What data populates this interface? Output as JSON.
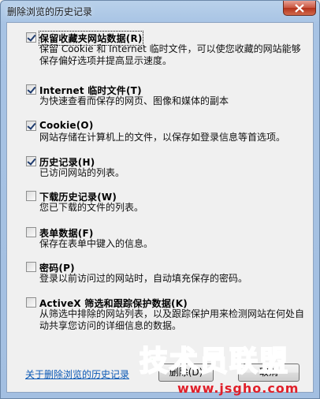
{
  "window": {
    "title": "删除浏览的历史记录"
  },
  "options": [
    {
      "label": "保留收藏夹网站数据(R)",
      "checked": true,
      "desc": "保留 Cookie 和 Internet 临时文件，可以使您收藏的网站能够保存偏好选项并提高显示速度。"
    },
    {
      "label": "Internet 临时文件(T)",
      "checked": true,
      "desc": "为快速查看而保存的网页、图像和媒体的副本"
    },
    {
      "label": "Cookie(O)",
      "checked": true,
      "desc": "网站存储在计算机上的文件，以保存如登录信息等首选项。"
    },
    {
      "label": "历史记录(H)",
      "checked": true,
      "desc": "已访问网站的列表。"
    },
    {
      "label": "下载历史记录(W)",
      "checked": false,
      "desc": "您已下载的文件的列表。"
    },
    {
      "label": "表单数据(F)",
      "checked": false,
      "desc": "保存在表单中键入的信息。"
    },
    {
      "label": "密码(P)",
      "checked": false,
      "desc": "登录以前访问过的网站时，自动填充保存的密码。"
    },
    {
      "label": "ActiveX 筛选和跟踪保护数据(K)",
      "checked": false,
      "desc": "从筛选中排除的网站列表，以及跟踪保护用来检测网站在何处自动共享您访问的详细信息的数据。"
    }
  ],
  "footer": {
    "help_link": "关于删除浏览的历史记录",
    "delete_label": "删除(D)",
    "cancel_label": "取消"
  },
  "watermark": {
    "text": "技术员联盟",
    "url": "www.jsgho.com",
    "color": "#2fbf2f",
    "url_color": "#e0202a"
  }
}
